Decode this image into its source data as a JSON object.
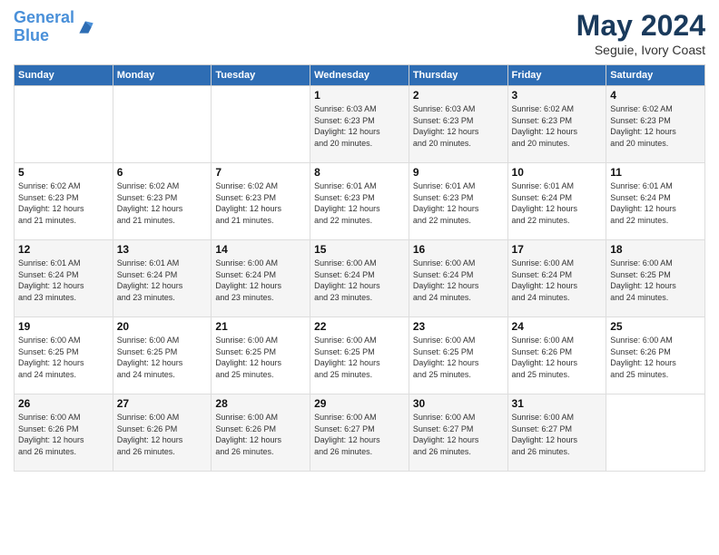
{
  "logo": {
    "line1": "General",
    "line2": "Blue"
  },
  "title": "May 2024",
  "subtitle": "Seguie, Ivory Coast",
  "header": {
    "days": [
      "Sunday",
      "Monday",
      "Tuesday",
      "Wednesday",
      "Thursday",
      "Friday",
      "Saturday"
    ]
  },
  "weeks": [
    [
      {
        "day": "",
        "info": ""
      },
      {
        "day": "",
        "info": ""
      },
      {
        "day": "",
        "info": ""
      },
      {
        "day": "1",
        "info": "Sunrise: 6:03 AM\nSunset: 6:23 PM\nDaylight: 12 hours\nand 20 minutes."
      },
      {
        "day": "2",
        "info": "Sunrise: 6:03 AM\nSunset: 6:23 PM\nDaylight: 12 hours\nand 20 minutes."
      },
      {
        "day": "3",
        "info": "Sunrise: 6:02 AM\nSunset: 6:23 PM\nDaylight: 12 hours\nand 20 minutes."
      },
      {
        "day": "4",
        "info": "Sunrise: 6:02 AM\nSunset: 6:23 PM\nDaylight: 12 hours\nand 20 minutes."
      }
    ],
    [
      {
        "day": "5",
        "info": "Sunrise: 6:02 AM\nSunset: 6:23 PM\nDaylight: 12 hours\nand 21 minutes."
      },
      {
        "day": "6",
        "info": "Sunrise: 6:02 AM\nSunset: 6:23 PM\nDaylight: 12 hours\nand 21 minutes."
      },
      {
        "day": "7",
        "info": "Sunrise: 6:02 AM\nSunset: 6:23 PM\nDaylight: 12 hours\nand 21 minutes."
      },
      {
        "day": "8",
        "info": "Sunrise: 6:01 AM\nSunset: 6:23 PM\nDaylight: 12 hours\nand 22 minutes."
      },
      {
        "day": "9",
        "info": "Sunrise: 6:01 AM\nSunset: 6:23 PM\nDaylight: 12 hours\nand 22 minutes."
      },
      {
        "day": "10",
        "info": "Sunrise: 6:01 AM\nSunset: 6:24 PM\nDaylight: 12 hours\nand 22 minutes."
      },
      {
        "day": "11",
        "info": "Sunrise: 6:01 AM\nSunset: 6:24 PM\nDaylight: 12 hours\nand 22 minutes."
      }
    ],
    [
      {
        "day": "12",
        "info": "Sunrise: 6:01 AM\nSunset: 6:24 PM\nDaylight: 12 hours\nand 23 minutes."
      },
      {
        "day": "13",
        "info": "Sunrise: 6:01 AM\nSunset: 6:24 PM\nDaylight: 12 hours\nand 23 minutes."
      },
      {
        "day": "14",
        "info": "Sunrise: 6:00 AM\nSunset: 6:24 PM\nDaylight: 12 hours\nand 23 minutes."
      },
      {
        "day": "15",
        "info": "Sunrise: 6:00 AM\nSunset: 6:24 PM\nDaylight: 12 hours\nand 23 minutes."
      },
      {
        "day": "16",
        "info": "Sunrise: 6:00 AM\nSunset: 6:24 PM\nDaylight: 12 hours\nand 24 minutes."
      },
      {
        "day": "17",
        "info": "Sunrise: 6:00 AM\nSunset: 6:24 PM\nDaylight: 12 hours\nand 24 minutes."
      },
      {
        "day": "18",
        "info": "Sunrise: 6:00 AM\nSunset: 6:25 PM\nDaylight: 12 hours\nand 24 minutes."
      }
    ],
    [
      {
        "day": "19",
        "info": "Sunrise: 6:00 AM\nSunset: 6:25 PM\nDaylight: 12 hours\nand 24 minutes."
      },
      {
        "day": "20",
        "info": "Sunrise: 6:00 AM\nSunset: 6:25 PM\nDaylight: 12 hours\nand 24 minutes."
      },
      {
        "day": "21",
        "info": "Sunrise: 6:00 AM\nSunset: 6:25 PM\nDaylight: 12 hours\nand 25 minutes."
      },
      {
        "day": "22",
        "info": "Sunrise: 6:00 AM\nSunset: 6:25 PM\nDaylight: 12 hours\nand 25 minutes."
      },
      {
        "day": "23",
        "info": "Sunrise: 6:00 AM\nSunset: 6:25 PM\nDaylight: 12 hours\nand 25 minutes."
      },
      {
        "day": "24",
        "info": "Sunrise: 6:00 AM\nSunset: 6:26 PM\nDaylight: 12 hours\nand 25 minutes."
      },
      {
        "day": "25",
        "info": "Sunrise: 6:00 AM\nSunset: 6:26 PM\nDaylight: 12 hours\nand 25 minutes."
      }
    ],
    [
      {
        "day": "26",
        "info": "Sunrise: 6:00 AM\nSunset: 6:26 PM\nDaylight: 12 hours\nand 26 minutes."
      },
      {
        "day": "27",
        "info": "Sunrise: 6:00 AM\nSunset: 6:26 PM\nDaylight: 12 hours\nand 26 minutes."
      },
      {
        "day": "28",
        "info": "Sunrise: 6:00 AM\nSunset: 6:26 PM\nDaylight: 12 hours\nand 26 minutes."
      },
      {
        "day": "29",
        "info": "Sunrise: 6:00 AM\nSunset: 6:27 PM\nDaylight: 12 hours\nand 26 minutes."
      },
      {
        "day": "30",
        "info": "Sunrise: 6:00 AM\nSunset: 6:27 PM\nDaylight: 12 hours\nand 26 minutes."
      },
      {
        "day": "31",
        "info": "Sunrise: 6:00 AM\nSunset: 6:27 PM\nDaylight: 12 hours\nand 26 minutes."
      },
      {
        "day": "",
        "info": ""
      }
    ]
  ]
}
